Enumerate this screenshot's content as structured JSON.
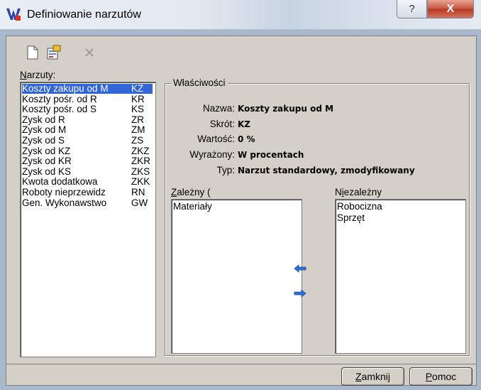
{
  "window": {
    "title": "Definiowanie narzutów",
    "help_glyph": "?",
    "close_glyph": "X"
  },
  "toolbar": {
    "items": [
      {
        "name": "new-document-icon",
        "enabled": true
      },
      {
        "name": "properties-icon",
        "enabled": true
      },
      {
        "name": "delete-icon",
        "enabled": false
      }
    ]
  },
  "narzuty": {
    "label_accel": "N",
    "label_rest": "arzuty:",
    "items": [
      {
        "name": "Koszty zakupu od M",
        "code": "KZ",
        "selected": true
      },
      {
        "name": "Koszty pośr. od R",
        "code": "KR"
      },
      {
        "name": "Koszty pośr. od S",
        "code": "KS"
      },
      {
        "name": "Zysk od R",
        "code": "ZR"
      },
      {
        "name": "Zysk od M",
        "code": "ZM"
      },
      {
        "name": "Zysk od S",
        "code": "ZS"
      },
      {
        "name": "Zysk od KZ",
        "code": "ZKZ"
      },
      {
        "name": "Zysk od KR",
        "code": "ZKR"
      },
      {
        "name": "Zysk od KS",
        "code": "ZKS"
      },
      {
        "name": "Kwota dodatkowa",
        "code": "ZKK"
      },
      {
        "name": "Roboty nieprzewidz",
        "code": "RN"
      },
      {
        "name": "Gen. Wykonawstwo",
        "code": "GW"
      }
    ]
  },
  "properties": {
    "title": "Właściwości",
    "rows": [
      {
        "label": "Nazwa:",
        "value": "Koszty zakupu od M"
      },
      {
        "label": "Skrót:",
        "value": "KZ"
      },
      {
        "label": "Wartość:",
        "value": "0 %"
      },
      {
        "label": "Wyrażony:",
        "value": "W procentach"
      },
      {
        "label": "Typ:",
        "value": "Narzut standardowy, zmodyfikowany"
      }
    ]
  },
  "zalezny": {
    "label_accel": "Z",
    "label_rest": "ależny (",
    "items": [
      "Materiały"
    ]
  },
  "niezalezny": {
    "label_pre": "N",
    "label_accel": "i",
    "label_rest": "ezależny",
    "items": [
      "Robocizna",
      "Sprzęt"
    ]
  },
  "arrows": {
    "left": "arrow-left-icon",
    "right": "arrow-right-icon",
    "color": "#2f6fd6"
  },
  "buttons": {
    "close": {
      "accel": "Z",
      "rest": "amknij"
    },
    "help": {
      "accel": "P",
      "rest": "omoc"
    }
  },
  "colors": {
    "selection": "#3166d8",
    "dialog_bg": "#d4d0c8",
    "close_button": "#c75643"
  }
}
